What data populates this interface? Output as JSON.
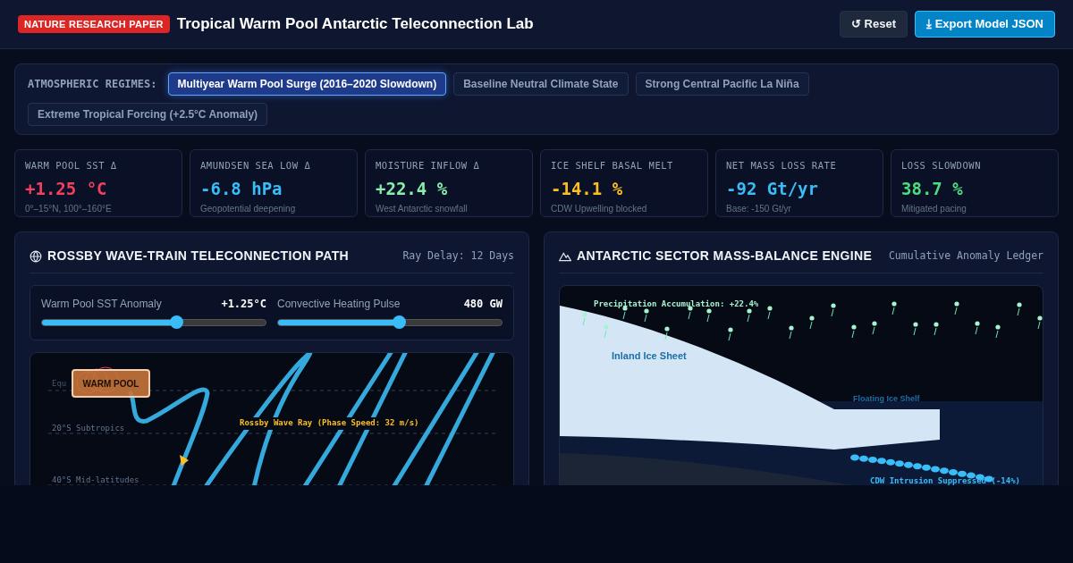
{
  "header": {
    "badge": "NATURE RESEARCH PAPER",
    "title": "Tropical Warm Pool Antarctic Teleconnection Lab",
    "buttons": [
      {
        "label": "↺ Reset",
        "kind": "secondary"
      },
      {
        "label": "⤓ Export Model JSON",
        "kind": "primary"
      }
    ]
  },
  "regimes": {
    "label": "ATMOSPHERIC REGIMES:",
    "items": [
      {
        "label": "Multiyear Warm Pool Surge (2016–2020 Slowdown)",
        "selected": true
      },
      {
        "label": "Baseline Neutral Climate State",
        "selected": false
      },
      {
        "label": "Strong Central Pacific La Niña",
        "selected": false
      },
      {
        "label": "Extreme Tropical Forcing (+2.5°C Anomaly)",
        "selected": false
      }
    ]
  },
  "metrics": [
    {
      "label": "WARM POOL SST Δ",
      "value": "+1.25 °C",
      "note": "0°–15°N, 100°–160°E",
      "color": "#f43f5e"
    },
    {
      "label": "AMUNDSEN SEA LOW Δ",
      "value": "-6.8 hPa",
      "note": "Geopotential deepening",
      "color": "#38bdf8"
    },
    {
      "label": "MOISTURE INFLOW Δ",
      "value": "+22.4 %",
      "note": "West Antarctic snowfall",
      "color": "#86efac"
    },
    {
      "label": "ICE SHELF BASAL MELT",
      "value": "-14.1 %",
      "note": "CDW Upwelling blocked",
      "color": "#fbbf24"
    },
    {
      "label": "NET MASS LOSS RATE",
      "value": "-92 Gt/yr",
      "note": "Base: -150 Gt/yr",
      "color": "#38bdf8"
    },
    {
      "label": "LOSS SLOWDOWN",
      "value": "38.7 %",
      "note": "Mitigated pacing",
      "color": "#4ade80"
    }
  ],
  "rossby_panel": {
    "title": "ROSSBY WAVE-TRAIN TELECONNECTION PATH",
    "meta": "Ray Delay: 12 Days",
    "sliders": [
      {
        "label": "Warm Pool SST Anomaly",
        "reading": "+1.25°C",
        "level": 0.6
      },
      {
        "label": "Convective Heating Pulse",
        "reading": "480 GW",
        "level": 0.54
      }
    ],
    "latitudes": [
      "Equ",
      "20°S Subtropics",
      "40°S Mid-latitudes"
    ],
    "source": "WARM POOL",
    "ray_label": "Rossby Wave Ray (Phase Speed: 32 m/s)"
  },
  "mass_panel": {
    "title": "ANTARCTIC SECTOR MASS-BALANCE ENGINE",
    "meta": "Cumulative Anomaly Ledger",
    "precip_label": "Precipitation Accumulation: +22.4%",
    "inland_label": "Inland Ice Sheet",
    "shelf_label": "Floating Ice Shelf",
    "cdw_label": "CDW Intrusion Suppressed (-14%)"
  }
}
